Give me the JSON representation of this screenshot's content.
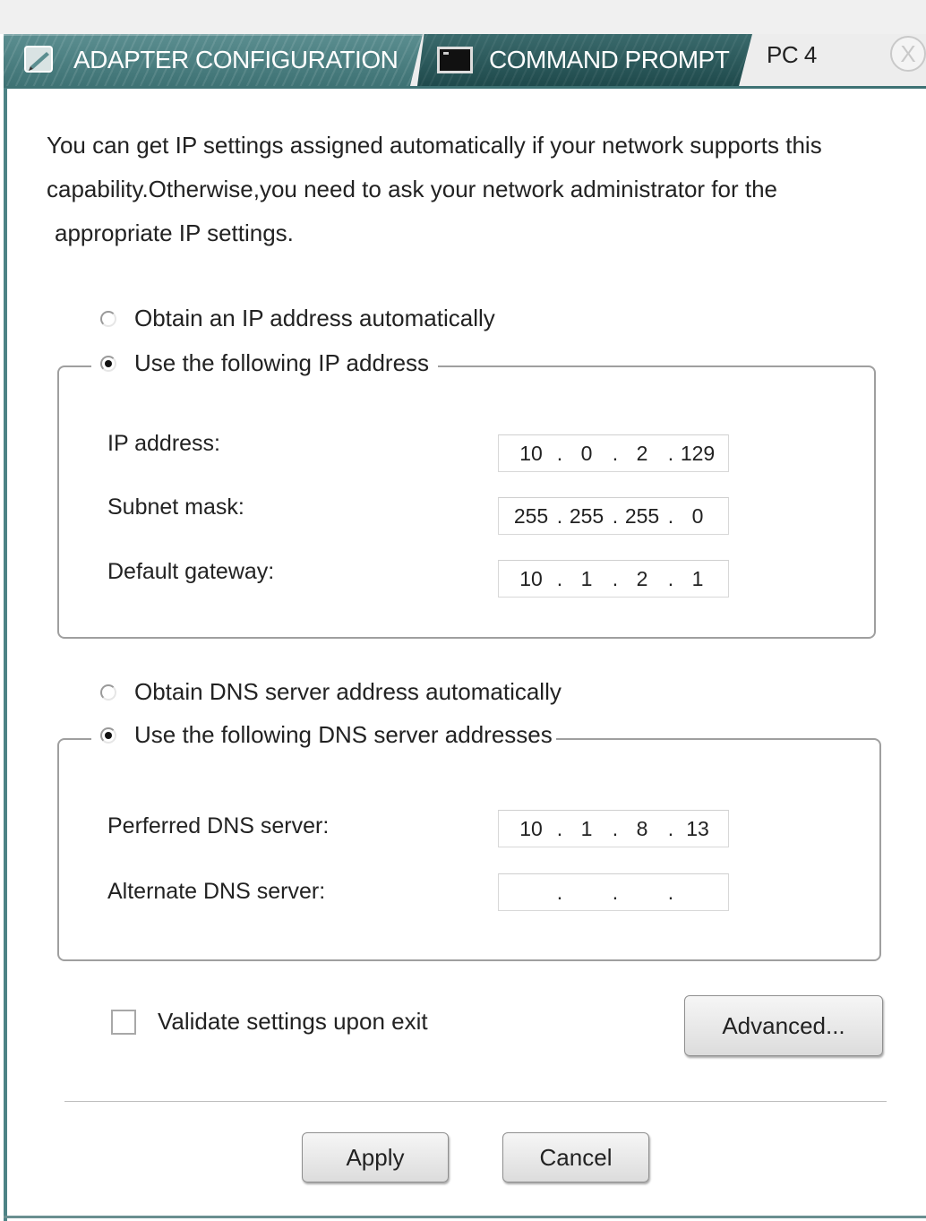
{
  "tabs": {
    "adapter_label": "ADAPTER CONFIGURATION",
    "command_label": "COMMAND PROMPT",
    "device_label": "PC 4",
    "close_symbol": "X"
  },
  "description": {
    "line1": "You can get IP settings assigned automatically if your network supports this",
    "line2": "capability.Otherwise,you need to ask your network administrator for the",
    "line3": "appropriate IP settings."
  },
  "ip_section": {
    "auto_label": "Obtain an IP address automatically",
    "manual_label": "Use the following IP address",
    "selected": "manual",
    "fields": [
      {
        "label": "IP address:",
        "octets": [
          "10",
          "0",
          "2",
          "129"
        ]
      },
      {
        "label": "Subnet mask:",
        "octets": [
          "255",
          "255",
          "255",
          "0"
        ]
      },
      {
        "label": "Default gateway:",
        "octets": [
          "10",
          "1",
          "2",
          "1"
        ]
      }
    ]
  },
  "dns_section": {
    "auto_label": "Obtain DNS server address automatically",
    "manual_label": "Use the following DNS server addresses",
    "selected": "manual",
    "fields": [
      {
        "label": "Perferred DNS server:",
        "octets": [
          "10",
          "1",
          "8",
          "13"
        ]
      },
      {
        "label": "Alternate DNS server:",
        "octets": [
          "",
          "",
          "",
          ""
        ]
      }
    ]
  },
  "validate": {
    "label": "Validate settings upon exit",
    "checked": false
  },
  "buttons": {
    "advanced": "Advanced...",
    "apply": "Apply",
    "cancel": "Cancel"
  },
  "colors": {
    "tab_active": "#4f8284",
    "tab_inactive": "#2c5a5c",
    "frame_border": "#4d8385"
  }
}
